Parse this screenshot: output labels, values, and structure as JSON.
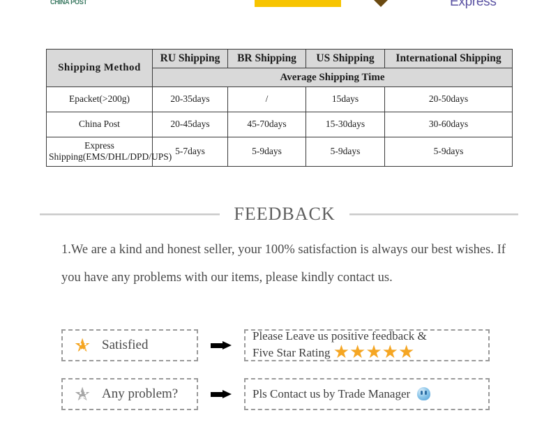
{
  "logos": {
    "china_post": "CHINA POST",
    "express": "Express",
    "yellow_bar_color": "#f7c400",
    "chevron_color": "#6b4a11",
    "express_color": "#5b53a3",
    "china_post_color": "#3c7a63"
  },
  "shipping_table": {
    "headers": [
      "Shipping  Method",
      "RU Shipping",
      "BR Shipping",
      "US Shipping",
      "International Shipping"
    ],
    "subheader": "Average Shipping Time",
    "rows": [
      {
        "method": "Epacket(>200g)",
        "ru": "20-35days",
        "br": "/",
        "us": "15days",
        "intl": "20-50days"
      },
      {
        "method": "China Post",
        "ru": "20-45days",
        "br": "45-70days",
        "us": "15-30days",
        "intl": "30-60days"
      },
      {
        "method": "Express Shipping(EMS/DHL/DPD/UPS)",
        "ru": "5-7days",
        "br": "5-9days",
        "us": "5-9days",
        "intl": "5-9days"
      }
    ],
    "header_bg": "#d9d9d9",
    "border_color": "#3a3a3a"
  },
  "feedback": {
    "title": "FEEDBACK",
    "paragraph": "1.We are a kind and honest seller, your 100% satisfaction is always our best wishes. If you have any problems with our items, please kindly contact us.",
    "rows": [
      {
        "left_label": "Satisfied",
        "left_icon": "smiling-star-icon",
        "right_line1": "Please Leave us positive feedback &",
        "right_line2": "Five Star Rating",
        "right_stars": "★★★★★",
        "arrow": "right-arrow-icon"
      },
      {
        "left_label": "Any problem?",
        "left_icon": "sad-star-icon",
        "right_line1": "Pls Contact us by Trade Manager",
        "right_line2": "",
        "right_icon": "trade-manager-icon",
        "arrow": "right-arrow-icon"
      }
    ],
    "star_color": "#f5a623",
    "sad_star_color": "#a8a8a8"
  }
}
